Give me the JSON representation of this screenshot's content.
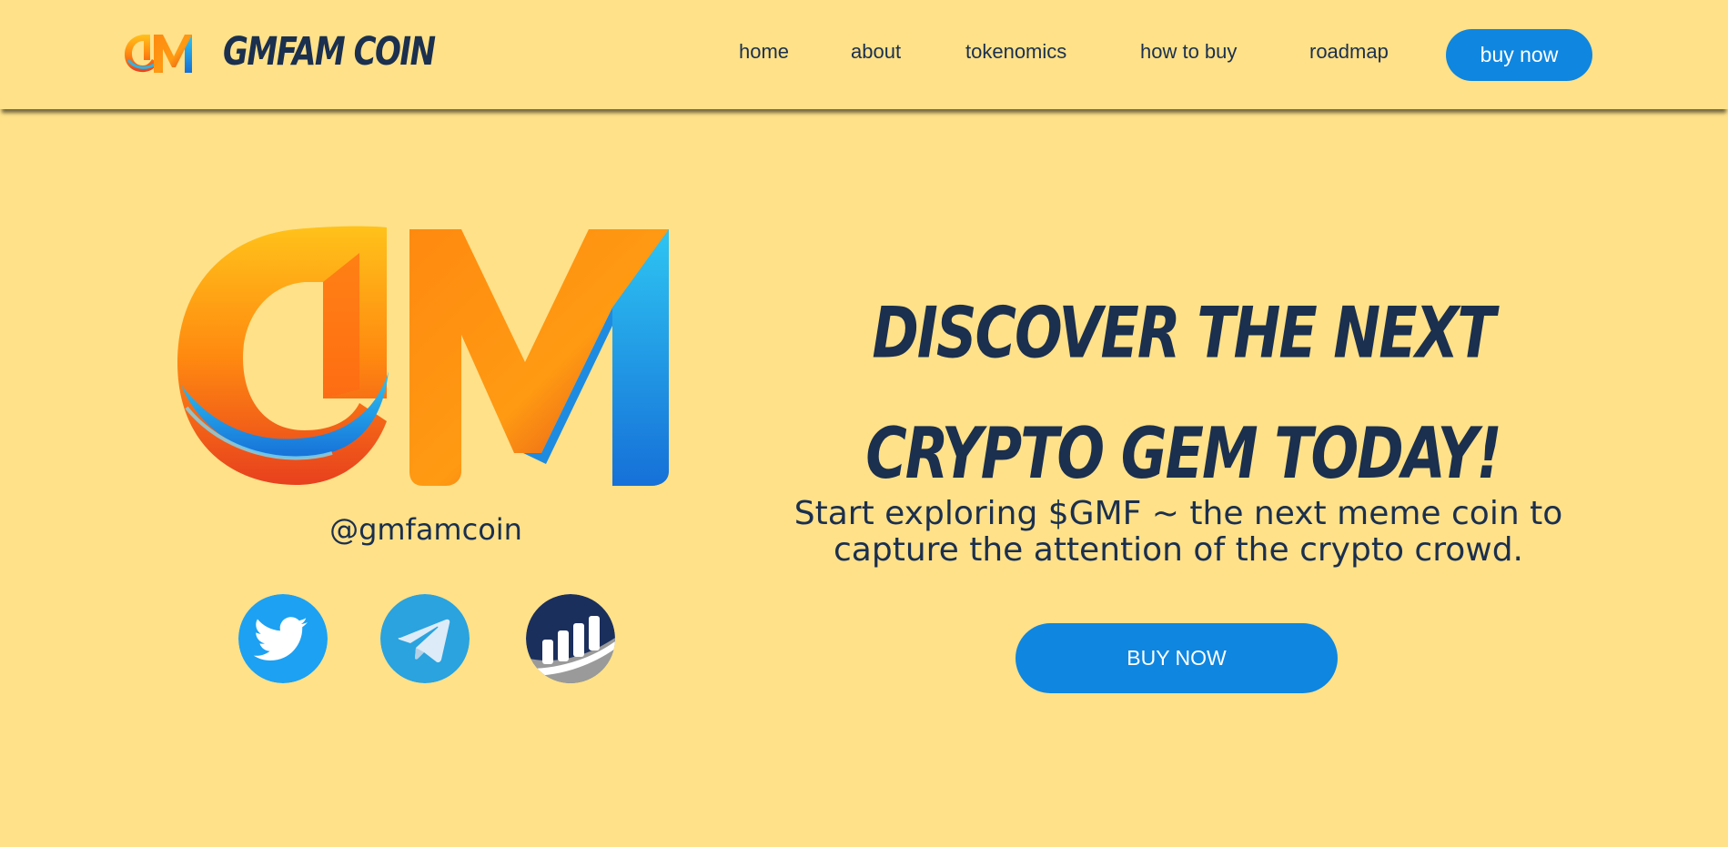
{
  "header": {
    "brand_name": "GMFAM COIN",
    "nav": [
      {
        "label": "home"
      },
      {
        "label": "about"
      },
      {
        "label": "tokenomics"
      },
      {
        "label": "how to buy"
      },
      {
        "label": "roadmap"
      }
    ],
    "buy_label": "buy now"
  },
  "hero": {
    "handle": "@gmfamcoin",
    "headline_line1": "DISCOVER THE NEXT",
    "headline_line2": "CRYPTO GEM TODAY!",
    "subtext": "Start exploring $GMF ~ the next meme coin to capture the attention of the crypto crowd.",
    "buy_label": "BUY NOW"
  },
  "social": [
    {
      "icon": "twitter-icon"
    },
    {
      "icon": "telegram-icon"
    },
    {
      "icon": "chart-icon"
    }
  ],
  "colors": {
    "background": "#FEE189",
    "text": "#1B2F4E",
    "accent": "#0F86E0",
    "twitter": "#1DA1F2",
    "telegram": "#2AA3DF",
    "chart": "#1B2F5C"
  }
}
